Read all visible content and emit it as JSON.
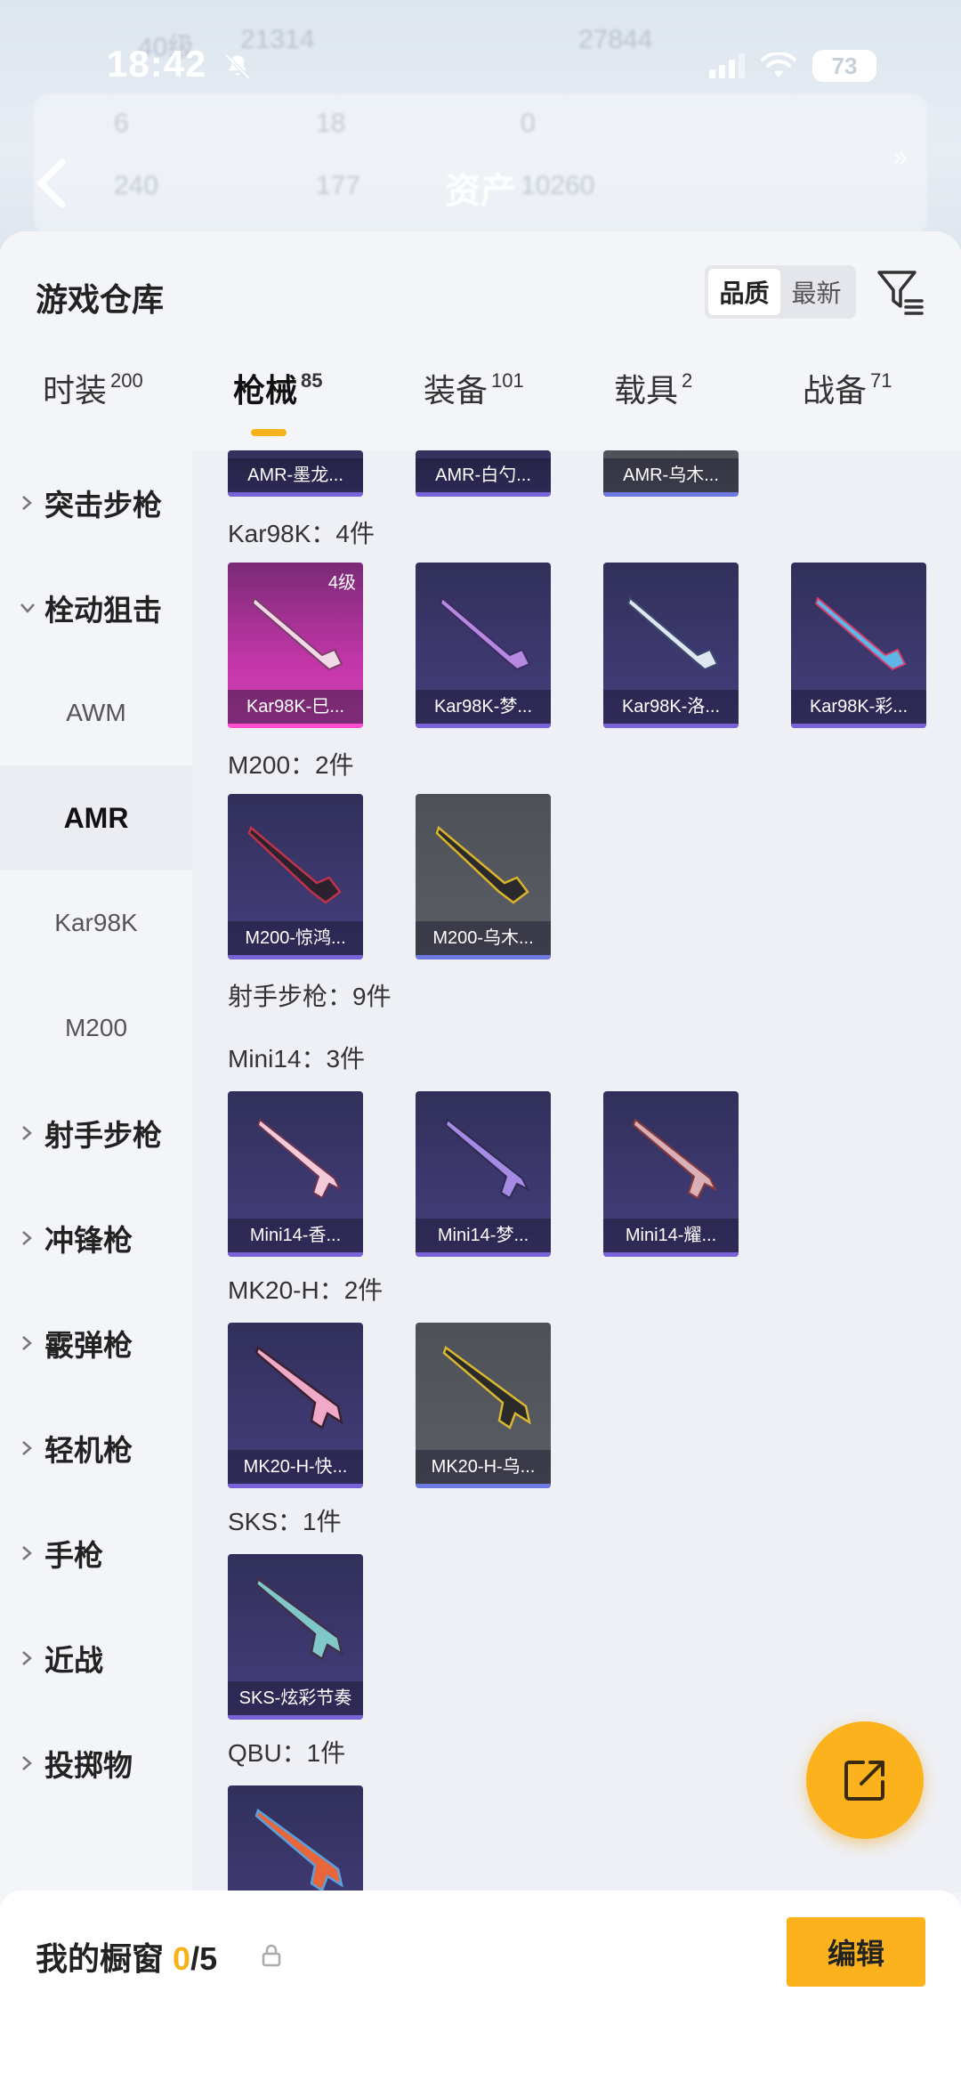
{
  "status_bar": {
    "time": "18:42",
    "battery": "73"
  },
  "backdrop": {
    "ghost_texts": [
      "40级",
      "21314",
      "27844",
      "6",
      "18",
      "0",
      "240",
      "177",
      "10260"
    ],
    "ghost_title": "资产"
  },
  "header": {
    "title": "游戏仓库",
    "sort_options": [
      {
        "label": "品质",
        "active": true
      },
      {
        "label": "最新",
        "active": false
      }
    ]
  },
  "tabs": [
    {
      "label": "时装",
      "count": "200",
      "active": false
    },
    {
      "label": "枪械",
      "count": "85",
      "active": true
    },
    {
      "label": "装备",
      "count": "101",
      "active": false
    },
    {
      "label": "载具",
      "count": "2",
      "active": false
    },
    {
      "label": "战备",
      "count": "71",
      "active": false
    }
  ],
  "sidebar": {
    "categories": [
      {
        "label": "突击步枪",
        "expanded": false
      },
      {
        "label": "栓动狙击",
        "expanded": true
      },
      {
        "label": "射手步枪",
        "expanded": false
      },
      {
        "label": "冲锋枪",
        "expanded": false
      },
      {
        "label": "霰弹枪",
        "expanded": false
      },
      {
        "label": "轻机枪",
        "expanded": false
      },
      {
        "label": "手枪",
        "expanded": false
      },
      {
        "label": "近战",
        "expanded": false
      },
      {
        "label": "投掷物",
        "expanded": false
      }
    ],
    "subitems": [
      {
        "label": "AWM",
        "active": false
      },
      {
        "label": "AMR",
        "active": true
      },
      {
        "label": "Kar98K",
        "active": false
      },
      {
        "label": "M200",
        "active": false
      }
    ]
  },
  "content": {
    "top_cards": [
      "AMR-墨龙...",
      "AMR-白勺...",
      "AMR-乌木..."
    ],
    "groups": [
      {
        "label": "Kar98K：4件",
        "items": [
          {
            "name": "Kar98K-巳...",
            "level": "4级",
            "style": "pink"
          },
          {
            "name": "Kar98K-梦...",
            "style": "purple"
          },
          {
            "name": "Kar98K-洛...",
            "style": "purple"
          },
          {
            "name": "Kar98K-彩...",
            "style": "purple"
          }
        ]
      },
      {
        "label": "M200：2件",
        "items": [
          {
            "name": "M200-惊鸿...",
            "style": "purple"
          },
          {
            "name": "M200-乌木...",
            "style": "gray"
          }
        ]
      },
      {
        "label": "射手步枪：9件",
        "items": []
      },
      {
        "label": "Mini14：3件",
        "items": [
          {
            "name": "Mini14-香...",
            "style": "purple"
          },
          {
            "name": "Mini14-梦...",
            "style": "purple"
          },
          {
            "name": "Mini14-耀...",
            "style": "purple"
          }
        ]
      },
      {
        "label": "MK20-H：2件",
        "items": [
          {
            "name": "MK20-H-快...",
            "style": "purple"
          },
          {
            "name": "MK20-H-乌...",
            "style": "gray"
          }
        ]
      },
      {
        "label": "SKS：1件",
        "items": [
          {
            "name": "SKS-炫彩节奏",
            "style": "purple"
          }
        ]
      },
      {
        "label": "QBU：1件",
        "items": [
          {
            "name": "",
            "style": "purple"
          }
        ]
      }
    ]
  },
  "showcase": {
    "label": "我的橱窗",
    "current": "0",
    "total": "/5",
    "edit_label": "编辑"
  },
  "colors": {
    "accent": "#fbb21d",
    "card_purple": "#463e7e",
    "card_gray": "#5c5e66",
    "card_pink": "#c236a8"
  },
  "icons": [
    "bell-mute-icon",
    "signal-icon",
    "wifi-icon",
    "back-arrow-icon",
    "filter-icon",
    "chevron-right-icon",
    "chevron-down-icon",
    "share-icon",
    "lock-icon"
  ]
}
